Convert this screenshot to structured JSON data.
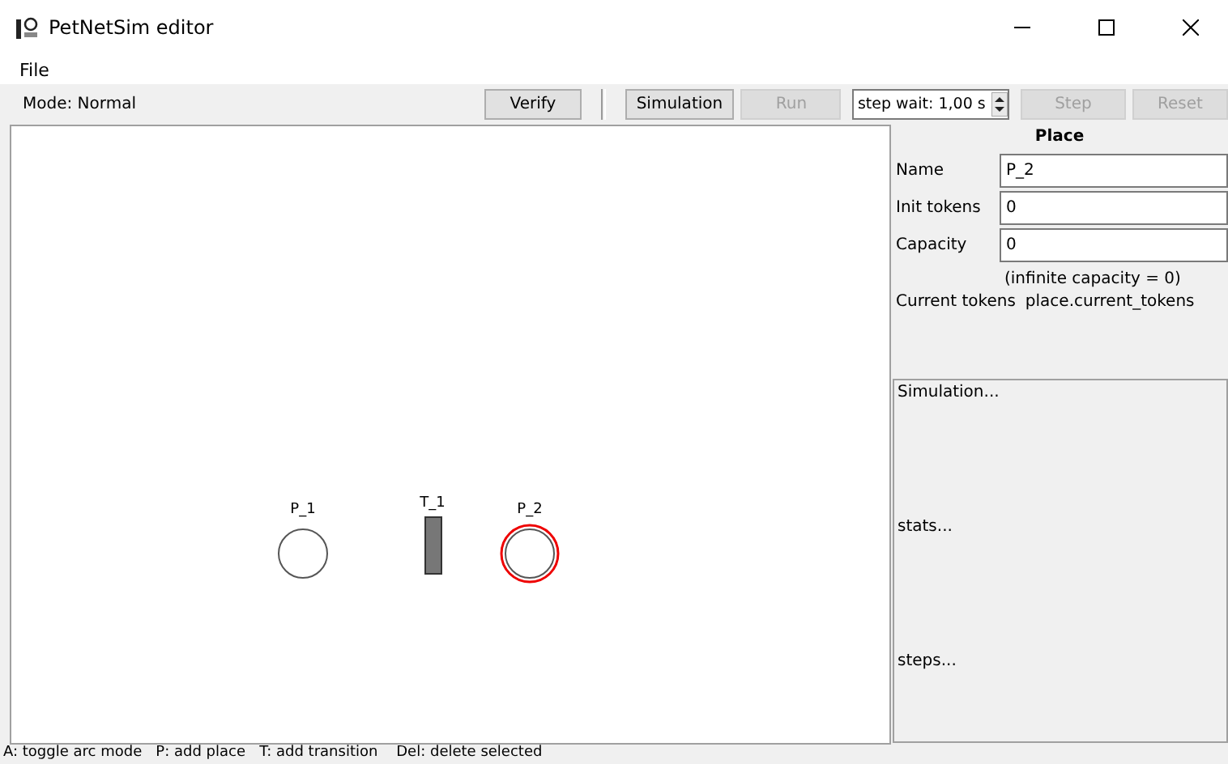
{
  "window": {
    "title": "PetNetSim editor"
  },
  "menu": [
    "File"
  ],
  "toolbar": {
    "mode": "Mode: Normal",
    "buttons": [
      {
        "label": "Verify",
        "disabled": false
      },
      {
        "label": "Simulation",
        "disabled": false
      },
      {
        "label": "Run",
        "disabled": true
      }
    ],
    "step_wait": {
      "value": "step wait: 1,00 s"
    },
    "buttons_after": [
      {
        "label": "Step",
        "disabled": true
      },
      {
        "label": "Reset",
        "disabled": true
      }
    ]
  },
  "canvas": {
    "nodes": [
      {
        "kind": "place",
        "label": "P_1",
        "selected": false
      },
      {
        "kind": "transition",
        "label": "T_1",
        "selected": false
      },
      {
        "kind": "place",
        "label": "P_2",
        "selected": true
      }
    ]
  },
  "properties": {
    "title": "Place",
    "fields": [
      {
        "label": "Name",
        "value": "P_2"
      },
      {
        "label": "Init tokens",
        "value": "0"
      },
      {
        "label": "Capacity",
        "value": "0"
      }
    ],
    "hint": "(infinite capacity = 0)",
    "current_tokens": {
      "label": "Current tokens",
      "value": "place.current_tokens"
    }
  },
  "simulation_log": [
    "Simulation...",
    "stats...",
    "steps..."
  ],
  "status_bar": "A: toggle arc mode   P: add place   T: add transition    Del: delete selected"
}
